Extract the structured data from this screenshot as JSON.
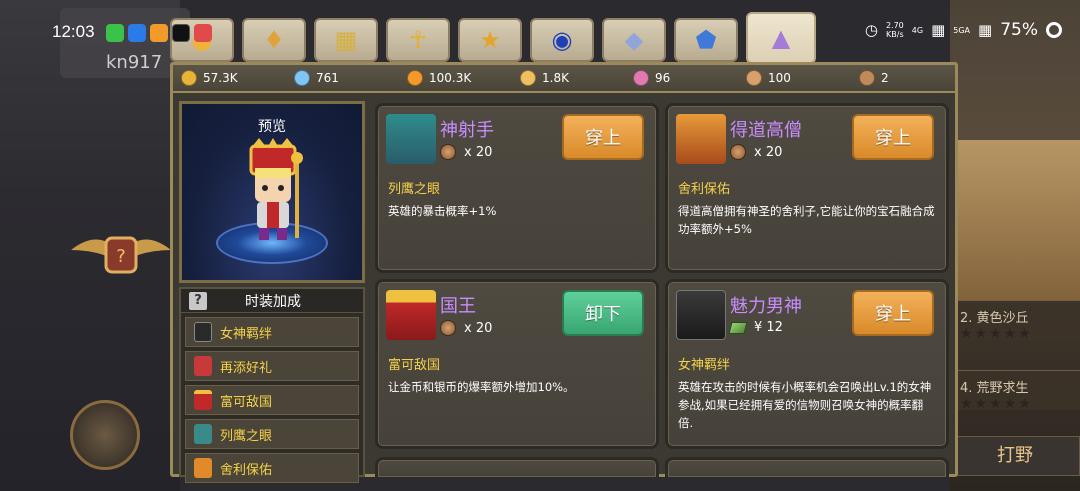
{
  "status_bar": {
    "time": "12:03",
    "net_speed_value": "2.70",
    "net_speed_unit": "KB/s",
    "net_4g": "4G",
    "net_5g": "5GA",
    "battery": "75%"
  },
  "background": {
    "username": "kn917",
    "stage_2": "2. 黄色沙丘",
    "stage_4": "4. 荒野求生",
    "hunt_label": "打野",
    "stars": "★★★★★"
  },
  "tabs": [
    {
      "name": "tab-hero",
      "icon": "person-icon",
      "active": false
    },
    {
      "name": "tab-mount",
      "icon": "dragon-head-icon",
      "active": false
    },
    {
      "name": "tab-shop",
      "icon": "shop-stall-icon",
      "active": false
    },
    {
      "name": "tab-ankh",
      "icon": "ankh-icon",
      "active": false
    },
    {
      "name": "tab-trophy",
      "icon": "trophy-icon",
      "active": false
    },
    {
      "name": "tab-orb",
      "icon": "orb-icon",
      "active": false
    },
    {
      "name": "tab-gem-ring",
      "icon": "gem-ring-icon",
      "active": false
    },
    {
      "name": "tab-crystal",
      "icon": "crystal-icon",
      "active": false
    },
    {
      "name": "tab-costume",
      "icon": "shirt-icon",
      "active": true
    }
  ],
  "currencies": [
    {
      "icon": "gold-coin-icon",
      "value": "57.3K",
      "color": "#e8b33a"
    },
    {
      "icon": "diamond-icon",
      "value": "761",
      "color": "#7fc6f5"
    },
    {
      "icon": "orange-orb-icon",
      "value": "100.3K",
      "color": "#f39a2b"
    },
    {
      "icon": "star-shard-icon",
      "value": "1.8K",
      "color": "#f0c060"
    },
    {
      "icon": "pink-star-icon",
      "value": "96",
      "color": "#e07ab0"
    },
    {
      "icon": "spark-icon",
      "value": "100",
      "color": "#d8a06a"
    },
    {
      "icon": "medal-icon",
      "value": "2",
      "color": "#c08a5a"
    }
  ],
  "preview": {
    "label": "预览"
  },
  "bonus": {
    "title": "时装加成",
    "help": "?",
    "items": [
      "女神羁绊",
      "再添好礼",
      "富可敌国",
      "列鹰之眼",
      "舍利保佑"
    ]
  },
  "cards": [
    {
      "title": "神射手",
      "cost_type": "coin",
      "cost": "x 20",
      "button": "穿上",
      "bonus_name": "列鹰之眼",
      "desc": "英雄的暴击概率+1%"
    },
    {
      "title": "得道高僧",
      "cost_type": "coin",
      "cost": "x 20",
      "button": "穿上",
      "bonus_name": "舍利保佑",
      "desc": "得道高僧拥有神圣的舍利子,它能让你的宝石融合成功率额外+5%"
    },
    {
      "title": "国王",
      "cost_type": "coin",
      "cost": "x 20",
      "button": "卸下",
      "bonus_name": "富可敌国",
      "desc": "让金币和银币的爆率额外增加10%。"
    },
    {
      "title": "魅力男神",
      "cost_type": "yen",
      "cost": "¥ 12",
      "button": "穿上",
      "bonus_name": "女神羁绊",
      "desc": "英雄在攻击的时候有小概率机会召唤出Lv.1的女神参战,如果已经拥有爱的信物则召唤女神的概率翻倍."
    }
  ]
}
